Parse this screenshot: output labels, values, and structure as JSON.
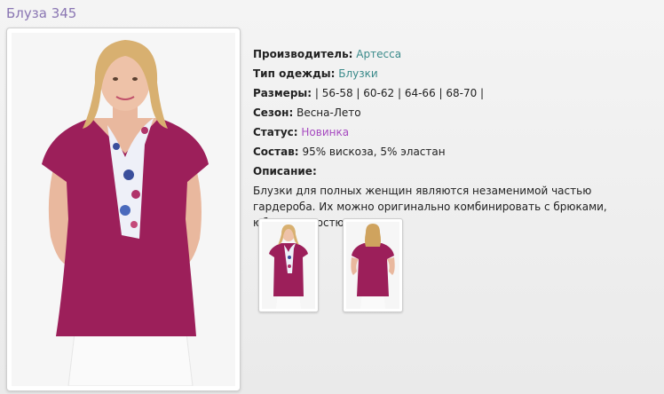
{
  "product": {
    "title": "Блуза 345",
    "manufacturer_label": "Производитель:",
    "manufacturer_value": "Артесса",
    "type_label": "Тип одежды:",
    "type_value": "Блузки",
    "sizes_label": "Размеры:",
    "sizes_value": "| 56-58 | 60-62 | 64-66 | 68-70 |",
    "season_label": "Сезон:",
    "season_value": "Весна-Лето",
    "status_label": "Статус:",
    "status_value": "Новинка",
    "composition_label": "Состав:",
    "composition_value": "95% вискоза, 5% эластан",
    "description_label": "Описание:",
    "description_text": "Блузки для полных женщин являются незаменимой частью гардероба. Их можно оригинально комбинировать с брюками, юбками и костюмами."
  },
  "colors": {
    "title": "#8a76b3",
    "link_green": "#3a8a8a",
    "link_purple": "#a64ac0",
    "blouse": "#9c1f5a"
  },
  "images": {
    "main": "model-front-photo",
    "thumbs": [
      "model-front-thumbnail",
      "model-back-thumbnail"
    ]
  }
}
